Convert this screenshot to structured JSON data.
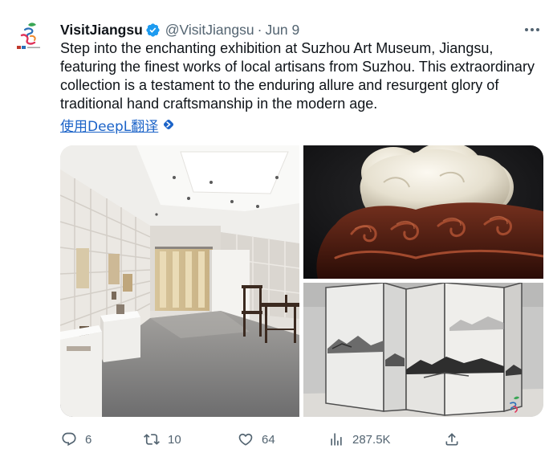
{
  "tweet": {
    "display_name": "VisitJiangsu",
    "verified": true,
    "verified_icon": "verified-badge-icon",
    "handle": "@VisitJiangsu",
    "separator": "·",
    "date": "Jun 9",
    "more_icon": "more-icon",
    "text_lines": [
      "Step into the enchanting exhibition at Suzhou Art Museum, Jiangsu,",
      "featuring the finest works of local artisans from Suzhou. This extraordinary",
      "collection is a testament to the enduring allure and resurgent glory of",
      "traditional hand craftsmanship in the modern age."
    ],
    "translate_link": "使用DeepL翻译",
    "translate_icon": "deepl-icon"
  },
  "actions": {
    "reply": {
      "icon": "reply-icon",
      "count": "6"
    },
    "retweet": {
      "icon": "retweet-icon",
      "count": "10"
    },
    "like": {
      "icon": "heart-icon",
      "count": "64"
    },
    "views": {
      "icon": "views-icon",
      "count": "287.5K"
    },
    "share": {
      "icon": "share-icon"
    }
  },
  "colors": {
    "text": "#0f1419",
    "secondary": "#536471",
    "link": "#1b63c8",
    "verified": "#1d9bf0",
    "background": "#ffffff"
  }
}
